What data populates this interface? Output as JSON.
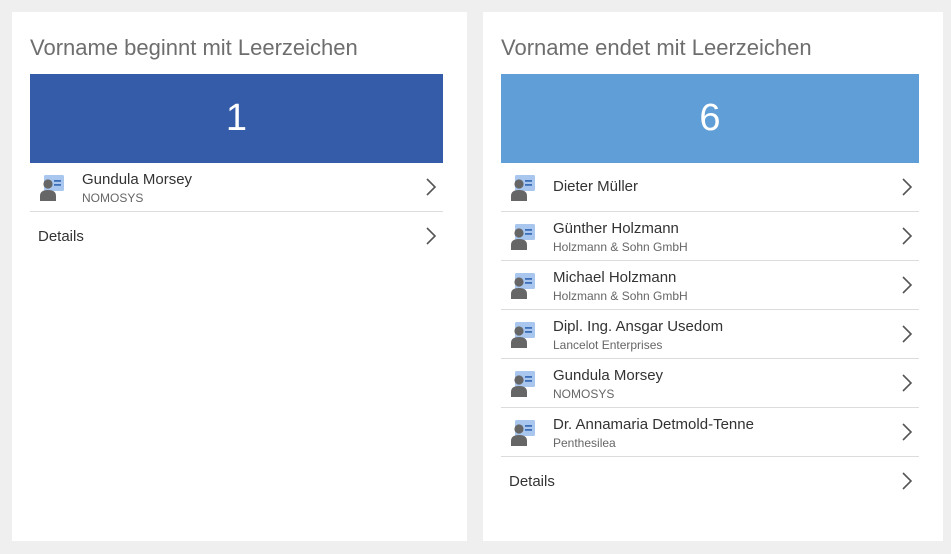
{
  "colors": {
    "left_tile": "#345ca8",
    "right_tile": "#5f9ed6",
    "icon_card": "#a9c7ee",
    "icon_person": "#666666"
  },
  "left_card": {
    "title": "Vorname beginnt mit Leerzeichen",
    "count": "1",
    "contacts": [
      {
        "name": "Gundula Morsey",
        "company": "NOMOSYS"
      }
    ],
    "details_label": "Details"
  },
  "right_card": {
    "title": "Vorname endet mit Leerzeichen",
    "count": "6",
    "contacts": [
      {
        "name": "Dieter Müller",
        "company": ""
      },
      {
        "name": "Günther Holzmann",
        "company": "Holzmann & Sohn GmbH"
      },
      {
        "name": "Michael Holzmann",
        "company": "Holzmann & Sohn GmbH"
      },
      {
        "name": "Dipl. Ing. Ansgar Usedom",
        "company": "Lancelot Enterprises"
      },
      {
        "name": "Gundula Morsey",
        "company": "NOMOSYS"
      },
      {
        "name": "Dr. Annamaria Detmold-Tenne",
        "company": "Penthesilea"
      }
    ],
    "details_label": "Details"
  }
}
